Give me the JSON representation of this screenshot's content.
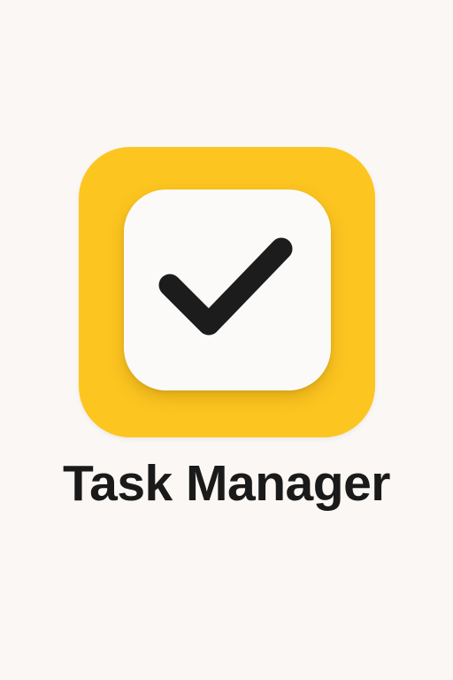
{
  "app": {
    "title": "Task Manager",
    "icon": "checkmark-icon"
  },
  "colors": {
    "background": "#faf7f4",
    "icon_accent": "#fdc520",
    "icon_tile": "#fbfaf8",
    "checkmark": "#1c1c1c",
    "title_text": "#1a1a1a"
  }
}
